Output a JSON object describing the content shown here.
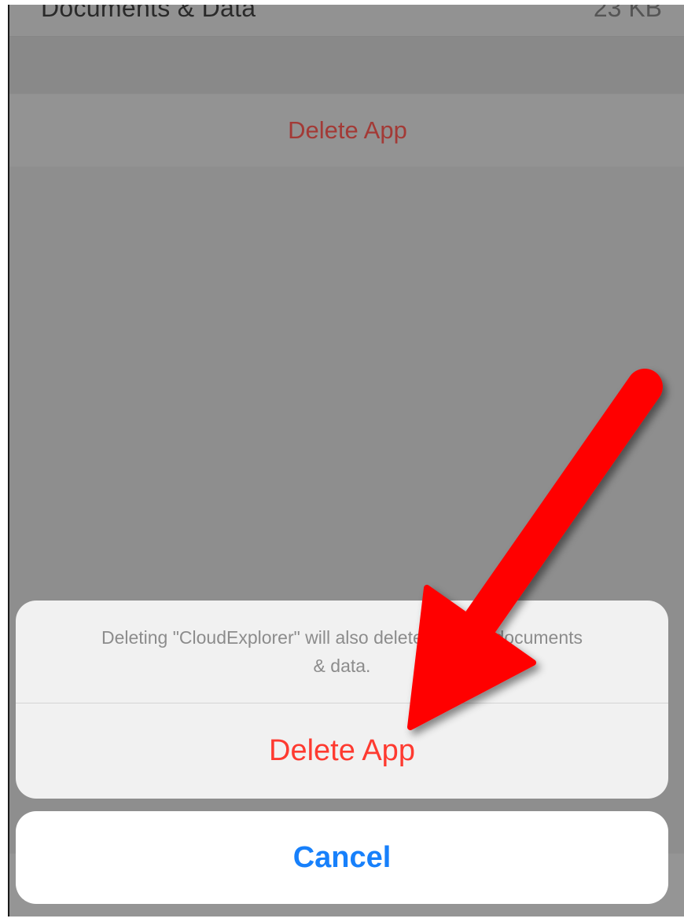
{
  "settings": {
    "documents_row_label": "Documents & Data",
    "documents_row_value": "23 KB",
    "delete_app_label": "Delete App"
  },
  "action_sheet": {
    "message": "Deleting \"CloudExplorer\" will also delete all of its documents & data.",
    "delete_label": "Delete App",
    "cancel_label": "Cancel"
  },
  "annotation": {
    "arrow_color": "#ff0000",
    "icon": "red-arrow-icon"
  },
  "colors": {
    "destructive": "#fe3a30",
    "accent": "#1780fb"
  }
}
